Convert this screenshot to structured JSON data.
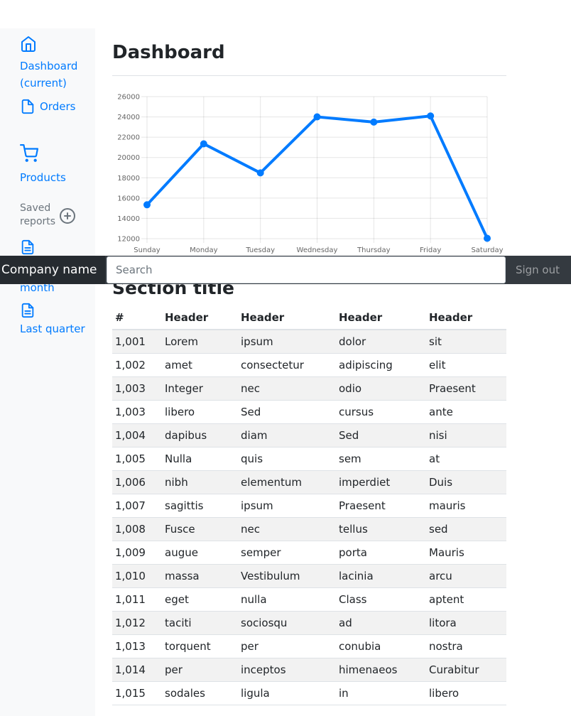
{
  "brand": "Company name",
  "search": {
    "placeholder": "Search"
  },
  "signout_label": "Sign out",
  "sidebar": {
    "items": [
      {
        "label": "Dashboard (current)",
        "icon": "home-icon"
      },
      {
        "label": "Orders",
        "icon": "file-icon"
      },
      {
        "label": "Products",
        "icon": "shopping-cart-icon"
      }
    ],
    "saved_reports_heading": "Saved reports",
    "reports": [
      {
        "label": "Current month",
        "icon": "file-text-icon"
      },
      {
        "label": "Last quarter",
        "icon": "file-text-icon"
      }
    ]
  },
  "page_title": "Dashboard",
  "section_title": "Section title",
  "colors": {
    "accent": "#007bff",
    "navbar": "#343a40",
    "sidebar": "#f8f9fa"
  },
  "chart_data": {
    "type": "line",
    "categories": [
      "Sunday",
      "Monday",
      "Tuesday",
      "Wednesday",
      "Thursday",
      "Friday",
      "Saturday"
    ],
    "values": [
      15339,
      21345,
      18483,
      24003,
      23489,
      24092,
      12034
    ],
    "ylim": [
      12000,
      26000
    ],
    "yticks": [
      12000,
      14000,
      16000,
      18000,
      20000,
      22000,
      24000,
      26000
    ],
    "grid": true,
    "color": "#007bff"
  },
  "table": {
    "headers": [
      "#",
      "Header",
      "Header",
      "Header",
      "Header"
    ],
    "rows": [
      [
        "1,001",
        "Lorem",
        "ipsum",
        "dolor",
        "sit"
      ],
      [
        "1,002",
        "amet",
        "consectetur",
        "adipiscing",
        "elit"
      ],
      [
        "1,003",
        "Integer",
        "nec",
        "odio",
        "Praesent"
      ],
      [
        "1,003",
        "libero",
        "Sed",
        "cursus",
        "ante"
      ],
      [
        "1,004",
        "dapibus",
        "diam",
        "Sed",
        "nisi"
      ],
      [
        "1,005",
        "Nulla",
        "quis",
        "sem",
        "at"
      ],
      [
        "1,006",
        "nibh",
        "elementum",
        "imperdiet",
        "Duis"
      ],
      [
        "1,007",
        "sagittis",
        "ipsum",
        "Praesent",
        "mauris"
      ],
      [
        "1,008",
        "Fusce",
        "nec",
        "tellus",
        "sed"
      ],
      [
        "1,009",
        "augue",
        "semper",
        "porta",
        "Mauris"
      ],
      [
        "1,010",
        "massa",
        "Vestibulum",
        "lacinia",
        "arcu"
      ],
      [
        "1,011",
        "eget",
        "nulla",
        "Class",
        "aptent"
      ],
      [
        "1,012",
        "taciti",
        "sociosqu",
        "ad",
        "litora"
      ],
      [
        "1,013",
        "torquent",
        "per",
        "conubia",
        "nostra"
      ],
      [
        "1,014",
        "per",
        "inceptos",
        "himenaeos",
        "Curabitur"
      ],
      [
        "1,015",
        "sodales",
        "ligula",
        "in",
        "libero"
      ]
    ]
  }
}
